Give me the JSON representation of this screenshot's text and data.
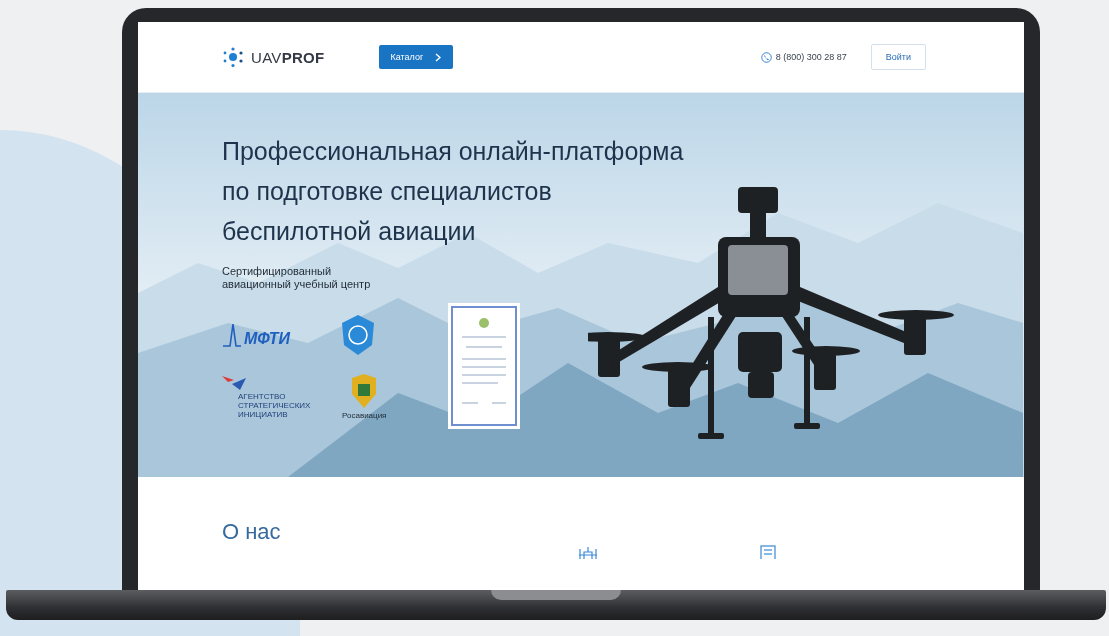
{
  "header": {
    "logo": "UAV**PROF**",
    "catalog_button": "Каталог",
    "phone": "8 (800) 300 28 87",
    "login_button": "Войти"
  },
  "hero": {
    "title_lines": [
      "Профессиональная онлайн-платформа",
      "по подготовке специалистов",
      "беспилотной авиации"
    ],
    "subtitle_lines": [
      "Сертифицированный",
      "авиационный учебный центр"
    ],
    "partners": [
      {
        "kind": "wordmark",
        "lines": [
          "МФТИ"
        ]
      },
      {
        "kind": "emblem"
      },
      {
        "kind": "agency",
        "lines": [
          "АГЕНТСТВО",
          "СТРАТЕГИЧЕСКИХ",
          "ИНИЦИАТИВ"
        ]
      },
      {
        "kind": "crest",
        "lines": [
          "Росавиация"
        ]
      }
    ]
  },
  "about": {
    "title": "О нас"
  }
}
